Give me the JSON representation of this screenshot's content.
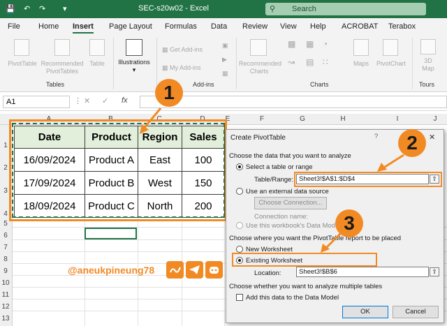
{
  "titlebar": {
    "doc_name": "SEC-s20w02",
    "app": "Excel",
    "search_placeholder": "Search",
    "accent": "#217346"
  },
  "ribbon_tabs": [
    "File",
    "Home",
    "Insert",
    "Page Layout",
    "Formulas",
    "Data",
    "Review",
    "View",
    "Help",
    "ACROBAT",
    "Terabox"
  ],
  "active_tab": "Insert",
  "ribbon": {
    "tables": {
      "pivottable": "PivotTable",
      "recommended_1": "Recommended",
      "recommended_2": "PivotTables",
      "table": "Table",
      "group": "Tables"
    },
    "illustrations": "Illustrations",
    "addins": {
      "get": "Get Add-ins",
      "my": "My Add-ins",
      "group": "Add-ins"
    },
    "charts": {
      "rec_1": "Recommended",
      "rec_2": "Charts",
      "maps": "Maps",
      "pivotchart": "PivotChart",
      "group": "Charts"
    },
    "tours": {
      "l1": "3D",
      "l2": "Map",
      "group": "Tours"
    }
  },
  "formula_bar": {
    "name_box": "A1",
    "fx": "fx"
  },
  "grid": {
    "columns": [
      "A",
      "B",
      "C",
      "D",
      "E",
      "F",
      "G",
      "H",
      "I",
      "J"
    ],
    "rows": [
      "1",
      "2",
      "3",
      "4",
      "5",
      "6",
      "7",
      "8",
      "9",
      "10",
      "11",
      "12",
      "13",
      "14"
    ]
  },
  "table": {
    "headers": [
      "Date",
      "Product",
      "Region",
      "Sales"
    ],
    "rows": [
      [
        "16/09/2024",
        "Product A",
        "East",
        "100"
      ],
      [
        "17/09/2024",
        "Product B",
        "West",
        "150"
      ],
      [
        "18/09/2024",
        "Product C",
        "North",
        "200"
      ]
    ]
  },
  "badges": [
    "1",
    "2",
    "3"
  ],
  "watermark": "@aneukpineung78",
  "dialog": {
    "title": "Create PivotTable",
    "section1": "Choose the data that you want to analyze",
    "opt_select": "Select a table or range",
    "table_range_label": "Table/Range:",
    "table_range_value": "Sheet3!$A$1:$D$4",
    "opt_external": "Use an external data source",
    "choose_connection": "Choose Connection...",
    "connection_name": "Connection name:",
    "opt_datamodel": "Use this workbook's Data Model",
    "section2": "Choose where you want the PivotTable report to be placed",
    "opt_new": "New Worksheet",
    "opt_existing": "Existing Worksheet",
    "location_label": "Location:",
    "location_value": "Sheet3!$B$6",
    "section3": "Choose whether you want to analyze multiple tables",
    "add_datamodel": "Add this data to the Data Model",
    "ok": "OK",
    "cancel": "Cancel"
  }
}
